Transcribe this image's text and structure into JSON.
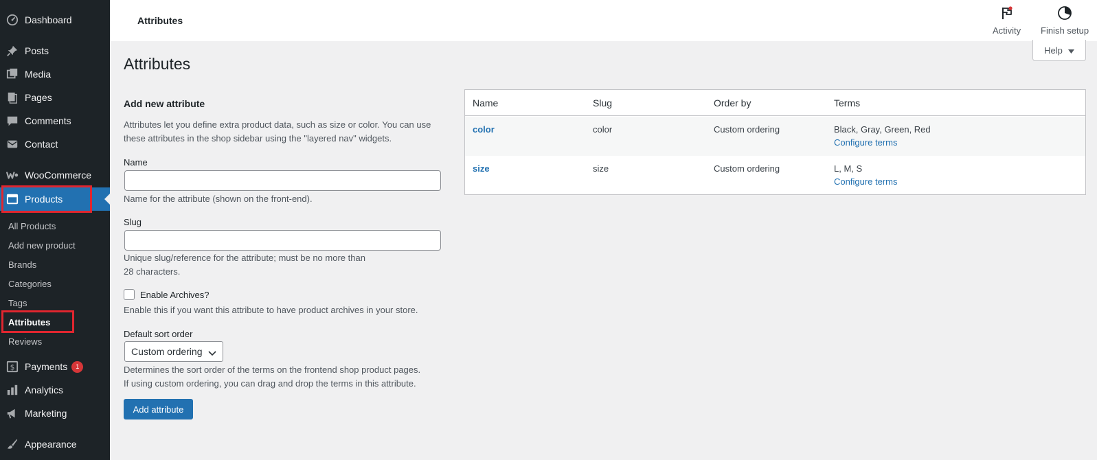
{
  "sidebar": {
    "items": [
      {
        "key": "dashboard",
        "label": "Dashboard",
        "icon": "dashboard-icon"
      },
      {
        "key": "posts",
        "label": "Posts",
        "icon": "pin-icon"
      },
      {
        "key": "media",
        "label": "Media",
        "icon": "media-icon"
      },
      {
        "key": "pages",
        "label": "Pages",
        "icon": "pages-icon"
      },
      {
        "key": "comments",
        "label": "Comments",
        "icon": "comment-icon"
      },
      {
        "key": "contact",
        "label": "Contact",
        "icon": "mail-icon"
      },
      {
        "key": "woocommerce",
        "label": "WooCommerce",
        "icon": "woo-icon"
      },
      {
        "key": "products",
        "label": "Products",
        "icon": "archive-icon"
      },
      {
        "key": "payments",
        "label": "Payments",
        "icon": "dollar-icon",
        "badge": "1"
      },
      {
        "key": "analytics",
        "label": "Analytics",
        "icon": "bar-chart-icon"
      },
      {
        "key": "marketing",
        "label": "Marketing",
        "icon": "megaphone-icon"
      },
      {
        "key": "appearance",
        "label": "Appearance",
        "icon": "brush-icon"
      }
    ],
    "submenu": [
      "All Products",
      "Add new product",
      "Brands",
      "Categories",
      "Tags",
      "Attributes",
      "Reviews"
    ]
  },
  "topbar": {
    "title": "Attributes",
    "activity_label": "Activity",
    "finish_setup_label": "Finish setup"
  },
  "help_label": "Help",
  "page_title": "Attributes",
  "form": {
    "heading": "Add new attribute",
    "intro_line1": "Attributes let you define extra product data, such as size or color. You can use",
    "intro_line2": "these attributes in the shop sidebar using the \"layered nav\" widgets.",
    "name_label": "Name",
    "name_value": "",
    "name_help": "Name for the attribute (shown on the front-end).",
    "slug_label": "Slug",
    "slug_value": "",
    "slug_help_line1": "Unique slug/reference for the attribute; must be no more than",
    "slug_help_line2": "28 characters.",
    "archives_label": "Enable Archives?",
    "archives_help": "Enable this if you want this attribute to have product archives in your store.",
    "sort_label": "Default sort order",
    "sort_value": "Custom ordering",
    "sort_help_line1": "Determines the sort order of the terms on the frontend shop product pages.",
    "sort_help_line2": "If using custom ordering, you can drag and drop the terms in this attribute.",
    "submit_label": "Add attribute"
  },
  "table": {
    "headers": [
      "Name",
      "Slug",
      "Order by",
      "Terms"
    ],
    "rows": [
      {
        "name": "color",
        "slug": "color",
        "order": "Custom ordering",
        "terms": "Black, Gray, Green, Red",
        "configure": "Configure terms"
      },
      {
        "name": "size",
        "slug": "size",
        "order": "Custom ordering",
        "terms": "L, M, S",
        "configure": "Configure terms"
      }
    ]
  },
  "colors": {
    "sidebar_bg": "#1d2327",
    "accent": "#2271b1",
    "highlight": "#e0262f",
    "badge": "#d63638"
  }
}
